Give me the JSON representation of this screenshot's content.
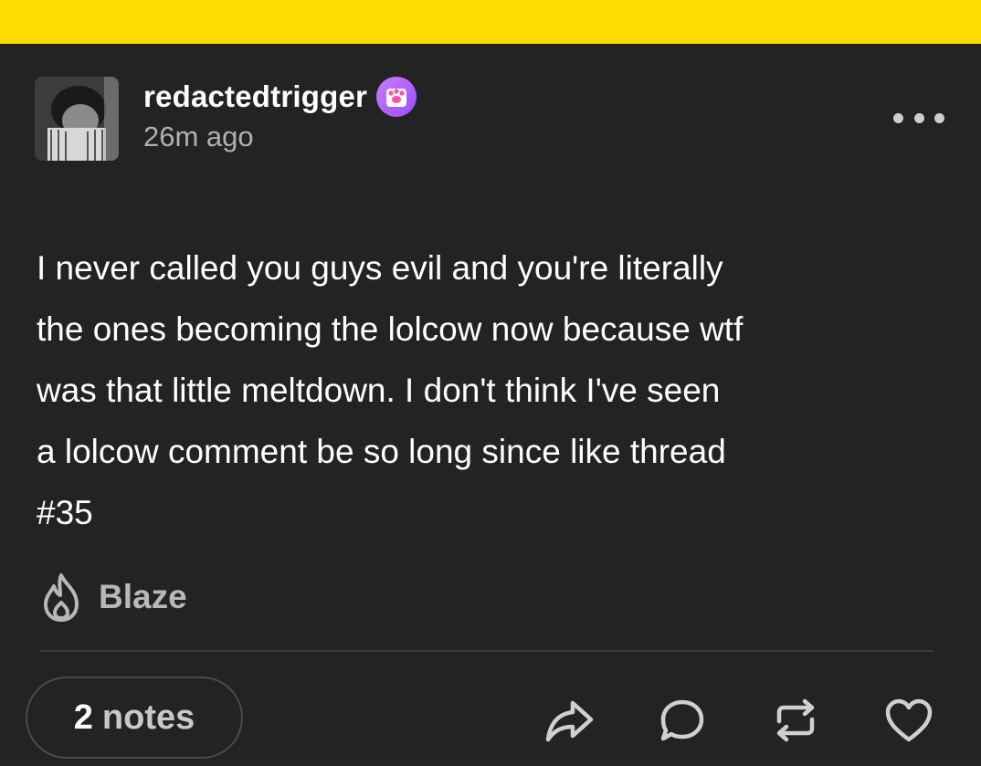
{
  "colors": {
    "top_bar": "#ffdc00",
    "background": "#222222",
    "badge": "#b366ff",
    "text": "#ffffff",
    "muted": "#b0b0b0"
  },
  "post": {
    "username": "redactedtrigger",
    "timestamp": "26m ago",
    "badge_icon": "paw-badge-icon",
    "body": "I never called you guys evil and you're literally\nthe ones becoming the lolcow now because wtf\nwas that little meltdown. I don't think I've seen\na lolcow comment be so long since like thread\n#35"
  },
  "blaze": {
    "icon": "flame-icon",
    "label": "Blaze"
  },
  "footer": {
    "notes_count": "2",
    "notes_label": "notes",
    "actions": [
      "share-icon",
      "reply-icon",
      "reblog-icon",
      "like-icon"
    ]
  }
}
